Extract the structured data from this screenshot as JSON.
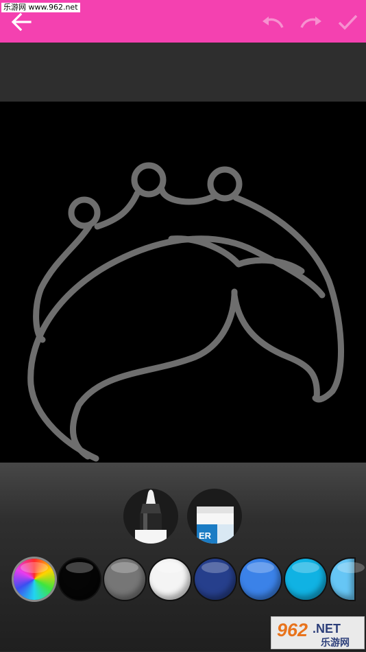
{
  "watermark_text": "乐游网 www.962.net",
  "appbar": {
    "bg_color": "#f441b0",
    "icons": {
      "back": "arrow-left-icon",
      "undo": "undo-icon",
      "redo": "redo-icon",
      "done": "check-icon"
    }
  },
  "drawing": {
    "stroke_color": "#6e6e6e",
    "background": "#000000"
  },
  "tools": {
    "marker": {
      "icon": "marker-icon"
    },
    "eraser": {
      "icon": "eraser-icon",
      "label": "ER"
    }
  },
  "palette": {
    "swatches": [
      {
        "name": "rainbow",
        "color": "rainbow"
      },
      {
        "name": "black",
        "color": "#050505"
      },
      {
        "name": "gray",
        "color": "#767676"
      },
      {
        "name": "white",
        "color": "#f4f4f4"
      },
      {
        "name": "navy",
        "color": "#263f8c"
      },
      {
        "name": "blue",
        "color": "#3b82e8"
      },
      {
        "name": "cyan",
        "color": "#10b2e3"
      },
      {
        "name": "light-blue",
        "color": "#66c6f5"
      }
    ]
  },
  "logo": {
    "number": "962",
    "suffix": ".NET",
    "caption": "乐游网"
  }
}
